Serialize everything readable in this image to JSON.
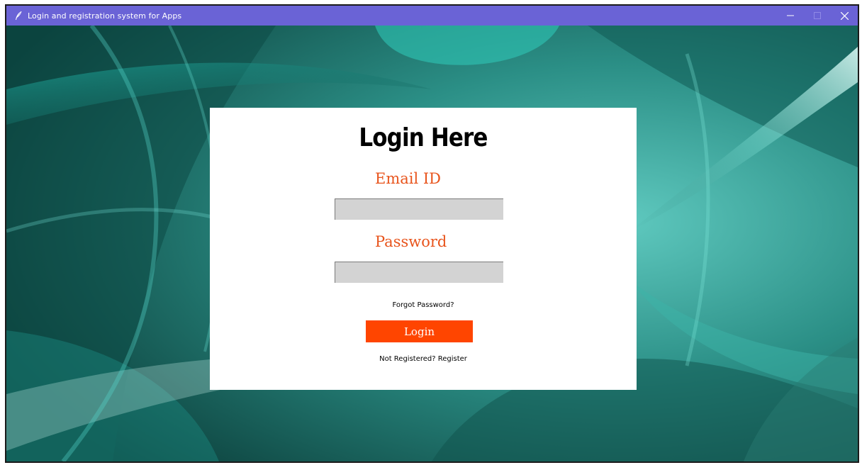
{
  "window": {
    "title": "Login and registration system for Apps",
    "icon": "feather-icon",
    "controls": [
      "minimize-icon",
      "maximize-icon",
      "close-icon"
    ]
  },
  "form": {
    "heading": "Login Here",
    "email_label": "Email ID",
    "email_value": "",
    "password_label": "Password",
    "password_value": "",
    "forgot_link": "Forgot Password?",
    "login_button": "Login",
    "register_link": "Not Registered? Register"
  },
  "colors": {
    "titlebar": "#6a63d6",
    "label": "#e8541c",
    "button": "#ff4500",
    "input": "#d3d3d3"
  }
}
